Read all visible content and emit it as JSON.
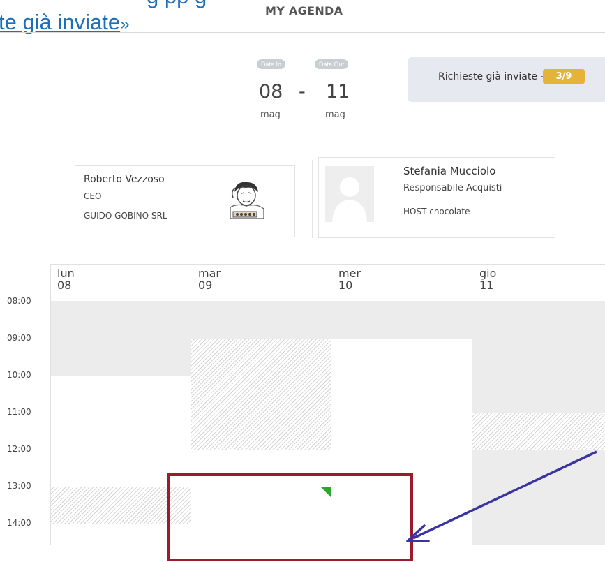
{
  "header": {
    "link_text": "te già inviate",
    "link_suffix": "»",
    "clipped_top_text": "g        pp                            g",
    "title": "MY AGENDA"
  },
  "dates": {
    "in_label": "Date In",
    "out_label": "Date Out",
    "in_day": "08",
    "separator": "-",
    "out_day": "11",
    "in_month": "mag",
    "out_month": "mag"
  },
  "sent_requests": {
    "label": "Richieste già inviate -",
    "count": "3/9"
  },
  "cards": {
    "left": {
      "name": "Roberto Vezzoso",
      "role": "CEO",
      "company": "GUIDO GOBINO SRL",
      "avatar_icon": "sketch-portrait-icon"
    },
    "right": {
      "name": "Stefania Mucciolo",
      "role": "Responsabile Acquisti",
      "company": "HOST chocolate",
      "avatar_icon": "default-user-icon"
    }
  },
  "calendar": {
    "days": [
      {
        "dow": "lun",
        "num": "08"
      },
      {
        "dow": "mar",
        "num": "09"
      },
      {
        "dow": "mer",
        "num": "10"
      },
      {
        "dow": "gio",
        "num": "11"
      }
    ],
    "times": [
      "08:00",
      "09:00",
      "10:00",
      "11:00",
      "12:00",
      "13:00",
      "14:00"
    ]
  },
  "annotation": {
    "box_color": "#9b1b2a",
    "arrow_color": "#3a33a0",
    "marker_color": "#2aa82a"
  }
}
